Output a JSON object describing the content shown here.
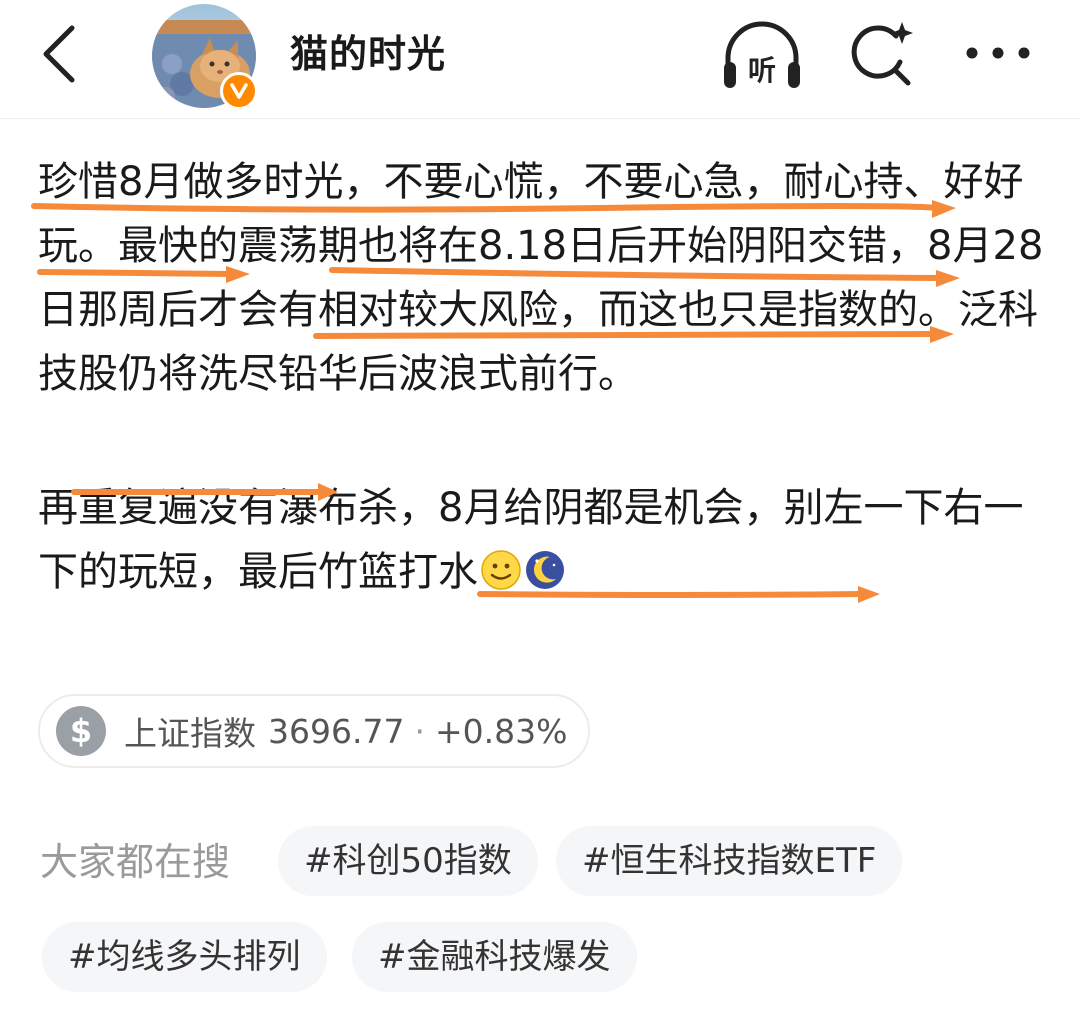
{
  "header": {
    "title": "猫的时光",
    "listen_label": "听",
    "icons": {
      "back": "chevron-left-icon",
      "listen": "headphones-icon",
      "search": "search-sparkle-icon",
      "more": "more-dots-icon",
      "verified": "verified-badge-icon"
    },
    "badge_color": "#ff8a00"
  },
  "post": {
    "paragraph1": "珍惜8月做多时光，不要心慌，不要心急，耐心持、好好玩。最快的震荡期也将在8.18日后开始阴阳交错，8月28日那周后才会有相对较大风险，而这也只是指数的。泛科技股仍将洗尽铅华后波浪式前行。",
    "paragraph2": "再重复遍没有瀑布杀，8月给阴都是机会，别左一下右一下的玩短，最后竹篮打水",
    "emojis": [
      "smile-emoji",
      "moon-emoji"
    ],
    "annotation_color": "#f58a3b"
  },
  "stock": {
    "icon": "dollar-icon",
    "symbol": "$",
    "name": "上证指数",
    "value": "3696.77",
    "separator": "·",
    "change": "+0.83%"
  },
  "hot_search": {
    "label": "大家都在搜",
    "tags": [
      "#科创50指数",
      "#恒生科技指数ETF",
      "#均线多头排列",
      "#金融科技爆发"
    ]
  }
}
